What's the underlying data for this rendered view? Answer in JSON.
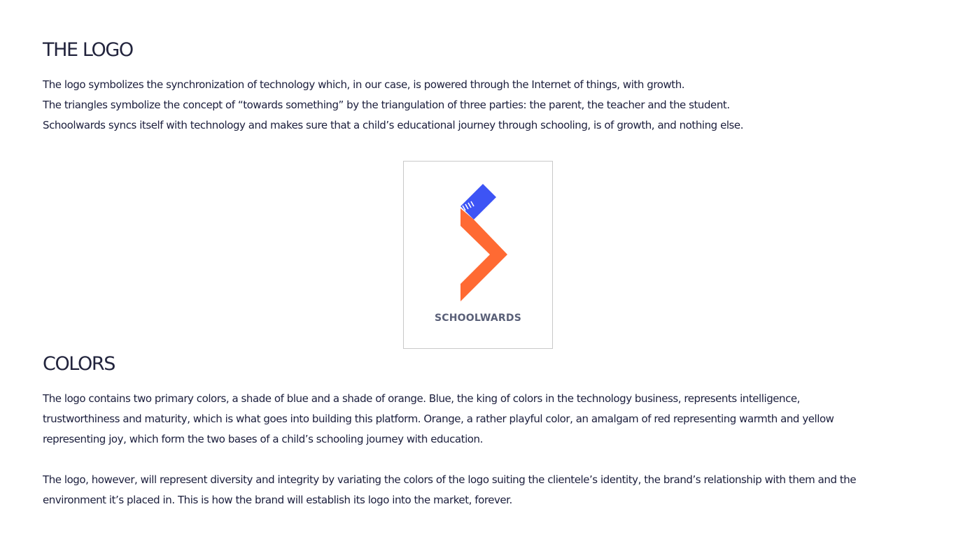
{
  "logo_section": {
    "heading": "THE LOGO",
    "lines": [
      "The logo symbolizes the synchronization of technology which, in our case, is powered through the Internet of things, with growth.",
      "The triangles symbolize the concept of “towards something” by the triangulation of three parties: the parent, the teacher and the student.",
      "Schoolwards syncs itself with technology and makes sure that a child’s educational journey through schooling, is of growth, and nothing else."
    ]
  },
  "logo_image": {
    "wordmark": "SCHOOLWARDS",
    "colors": {
      "blue": "#3d54f5",
      "orange": "#ff6a33",
      "wordmark": "#5a6078"
    }
  },
  "colors_section": {
    "heading": "COLORS",
    "paragraph_1_lines": [
      "The logo contains two primary colors, a shade of blue and a shade of orange. Blue, the king of colors in the technology business, represents intelligence,",
      "trustworthiness and maturity, which is what goes into building this platform. Orange, a rather playful color, an amalgam of red representing warmth and yellow",
      "representing joy, which form the two bases of a child’s schooling journey with education."
    ],
    "paragraph_2_lines": [
      "The logo, however, will represent diversity and integrity by variating the colors of the logo suiting the clientele’s identity, the brand’s relationship with them and the",
      "environment it’s placed in. This is how the brand will establish its logo into the market, forever."
    ]
  }
}
